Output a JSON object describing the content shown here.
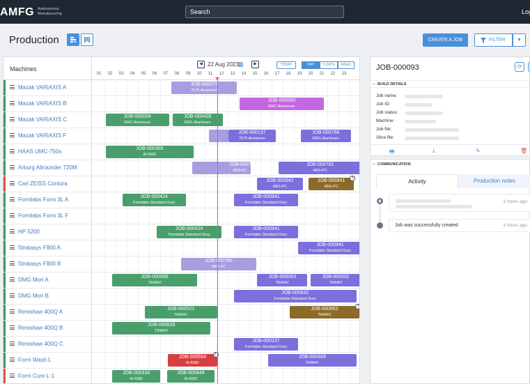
{
  "topbar": {
    "logo": "AMFG",
    "logo_sub": "Autonomous Manufacturing",
    "search_placeholder": "Search",
    "login": "Login"
  },
  "header": {
    "title": "Production",
    "create_label": "CREATE A JOB",
    "filter_label": "FILTER"
  },
  "scheduler": {
    "machines_header": "Machines",
    "date": "22 Aug 2023",
    "today_label": "TODAY",
    "ranges": [
      "DAY",
      "3 DAYS",
      "WEEK"
    ],
    "hours": [
      "01",
      "02",
      "03",
      "04",
      "05",
      "06",
      "07",
      "08",
      "09",
      "10",
      "11",
      "12",
      "13",
      "14",
      "15",
      "16",
      "17",
      "18",
      "19",
      "20",
      "21",
      "22",
      "23"
    ],
    "machines": [
      {
        "name": "Mazak VARIAXIS A",
        "status": "green"
      },
      {
        "name": "Mazak VARIAXIS B",
        "status": "green"
      },
      {
        "name": "Mazak VARIAXIS C",
        "status": "green"
      },
      {
        "name": "Mazak VARIAXIS F",
        "status": "green"
      },
      {
        "name": "HAAS UMC-750s",
        "status": "green"
      },
      {
        "name": "Arburg Allrounder 720M",
        "status": "green"
      },
      {
        "name": "Carl ZEISS Contura",
        "status": "red"
      },
      {
        "name": "Formlabs Form 3L A",
        "status": "green"
      },
      {
        "name": "Formlabs Form 3L F",
        "status": "green"
      },
      {
        "name": "HP 5200",
        "status": "green"
      },
      {
        "name": "Stratasys F900 A",
        "status": "green"
      },
      {
        "name": "Stratasys F900 B",
        "status": "green"
      },
      {
        "name": "DMG Mori A",
        "status": "green"
      },
      {
        "name": "DMG Mori B",
        "status": "green"
      },
      {
        "name": "Renishaw 400Q A",
        "status": "green"
      },
      {
        "name": "Renishaw 400Q B",
        "status": "green"
      },
      {
        "name": "Renishaw 400Q C",
        "status": "green"
      },
      {
        "name": "Form Wash L",
        "status": "green"
      },
      {
        "name": "Form Cure L-1",
        "status": "red"
      }
    ],
    "jobs": [
      {
        "row": 0,
        "start": 7.5,
        "end": 13.4,
        "id": "JOB-000075",
        "material": "7075 Aluminum",
        "color": "#a99de0",
        "warn": false
      },
      {
        "row": 1,
        "start": 13.6,
        "end": 21.2,
        "id": "JOB-000093",
        "material": "6061 Aluminum",
        "color": "#c467e0",
        "warn": false
      },
      {
        "row": 2,
        "start": 1.6,
        "end": 7.3,
        "id": "JOB-000054",
        "material": "6061 Aluminum",
        "color": "#4a9e6b",
        "warn": false
      },
      {
        "row": 2,
        "start": 7.6,
        "end": 12.1,
        "id": "JOB-000428",
        "material": "6061 Aluminum",
        "color": "#4a9e6b",
        "warn": false
      },
      {
        "row": 3,
        "start": 10.9,
        "end": 12.6,
        "id": "",
        "material": "",
        "color": "#a99de0",
        "warn": false
      },
      {
        "row": 3,
        "start": 12.6,
        "end": 16.9,
        "id": "JOB-000137",
        "material": "7075 Aluminum",
        "color": "#7b6fdc",
        "warn": false
      },
      {
        "row": 3,
        "start": 19.1,
        "end": 23.6,
        "id": "JOB-000758",
        "material": "6061 Aluminum",
        "color": "#7b6fdc",
        "warn": false
      },
      {
        "row": 4,
        "start": 1.6,
        "end": 9.5,
        "id": "JOB-000365",
        "material": "Al 6082",
        "color": "#4a9e6b",
        "warn": false
      },
      {
        "row": 5,
        "start": 9.4,
        "end": 12.7,
        "id": "",
        "material": "",
        "color": "#a99de0",
        "warn": false
      },
      {
        "row": 5,
        "start": 12.7,
        "end": 14.6,
        "id": "JOB-000780",
        "material": "ABS-PC",
        "color": "#a99de0",
        "warn": false
      },
      {
        "row": 5,
        "start": 17.1,
        "end": 24.6,
        "id": "JOB-000782",
        "material": "ABS-PC",
        "color": "#7b6fdc",
        "warn": false
      },
      {
        "row": 6,
        "start": 15.2,
        "end": 19.3,
        "id": "JOB-000941",
        "material": "ABS-PC",
        "color": "#7b6fdc",
        "warn": false
      },
      {
        "row": 6,
        "start": 19.8,
        "end": 23.9,
        "id": "JOB-000941",
        "material": "ABS-PC",
        "color": "#8c6a2a",
        "warn": true
      },
      {
        "row": 7,
        "start": 3.1,
        "end": 8.8,
        "id": "JOB-000424",
        "material": "Formlabs Standard Grey",
        "color": "#4a9e6b",
        "warn": false
      },
      {
        "row": 7,
        "start": 13.1,
        "end": 18.9,
        "id": "JOB-000941",
        "material": "Formlabs Standard Grey",
        "color": "#7b6fdc",
        "warn": false
      },
      {
        "row": 9,
        "start": 6.2,
        "end": 12.0,
        "id": "JOB-000424",
        "material": "Formlabs Standard Grey",
        "color": "#4a9e6b",
        "warn": false
      },
      {
        "row": 9,
        "start": 13.1,
        "end": 18.9,
        "id": "JOB-000941",
        "material": "Formlabs Standard Grey",
        "color": "#7b6fdc",
        "warn": false
      },
      {
        "row": 10,
        "start": 18.9,
        "end": 24.6,
        "id": "JOB-000941",
        "material": "Formlabs Standard Grey",
        "color": "#7b6fdc",
        "warn": false
      },
      {
        "row": 11,
        "start": 8.4,
        "end": 15.1,
        "id": "JOB-000780",
        "material": "ABS-PC",
        "color": "#a99de0",
        "warn": false
      },
      {
        "row": 12,
        "start": 2.2,
        "end": 9.8,
        "id": "JOB-000935",
        "material": "Ti6Al4V",
        "color": "#4a9e6b",
        "warn": false
      },
      {
        "row": 12,
        "start": 15.2,
        "end": 19.7,
        "id": "JOB-000043",
        "material": "Ti6Al4V",
        "color": "#7b6fdc",
        "warn": false
      },
      {
        "row": 12,
        "start": 20.0,
        "end": 24.5,
        "id": "JOB-000531",
        "material": "Ti6Al4V",
        "color": "#7b6fdc",
        "warn": false
      },
      {
        "row": 13,
        "start": 13.1,
        "end": 24.1,
        "id": "JOB-000842",
        "material": "Formlabs Standard Grey",
        "color": "#7b6fdc",
        "warn": false
      },
      {
        "row": 14,
        "start": 5.1,
        "end": 11.6,
        "id": "JOB-000521",
        "material": "Ti6Al4V",
        "color": "#4a9e6b",
        "warn": false
      },
      {
        "row": 14,
        "start": 18.1,
        "end": 24.4,
        "id": "JOB-000662",
        "material": "Ti6Al4V",
        "color": "#8c6a2a",
        "warn": true
      },
      {
        "row": 15,
        "start": 2.2,
        "end": 11.0,
        "id": "JOB-000628",
        "material": "Ti6Al4V",
        "color": "#4a9e6b",
        "warn": false
      },
      {
        "row": 16,
        "start": 13.1,
        "end": 18.9,
        "id": "JOB-000237",
        "material": "Formlabs Standard Grey",
        "color": "#7b6fdc",
        "warn": false
      },
      {
        "row": 17,
        "start": 7.2,
        "end": 11.6,
        "id": "JOB-000554",
        "material": "Al 6082",
        "color": "#d64040",
        "warn": true
      },
      {
        "row": 17,
        "start": 16.2,
        "end": 24.1,
        "id": "JOB-000469",
        "material": "Ti6Al4V",
        "color": "#7b6fdc",
        "warn": false
      },
      {
        "row": 18,
        "start": 2.2,
        "end": 6.5,
        "id": "JOB-000334",
        "material": "Al 6082",
        "color": "#4a9e6b",
        "warn": false
      },
      {
        "row": 18,
        "start": 7.1,
        "end": 11.4,
        "id": "JOB-000848",
        "material": "Al 6082",
        "color": "#4a9e6b",
        "warn": false
      }
    ]
  },
  "details": {
    "title": "JOB-000093",
    "section": "BUILD DETAILS",
    "fields": [
      "Job name:",
      "Job ID:",
      "Job status:",
      "Machine:",
      "Job file:",
      "Slice file:"
    ]
  },
  "communication": {
    "section": "COMMUNICATION",
    "tabs": [
      "Activity",
      "Production notes"
    ],
    "entries": [
      {
        "message": "",
        "time": "2 hours ago"
      },
      {
        "message": "Job was successfully created",
        "time": "4 hours ago"
      }
    ]
  },
  "colors": {
    "accent": "#4a90d9",
    "topbar": "#1f2733",
    "now_line": "#e046c6"
  }
}
